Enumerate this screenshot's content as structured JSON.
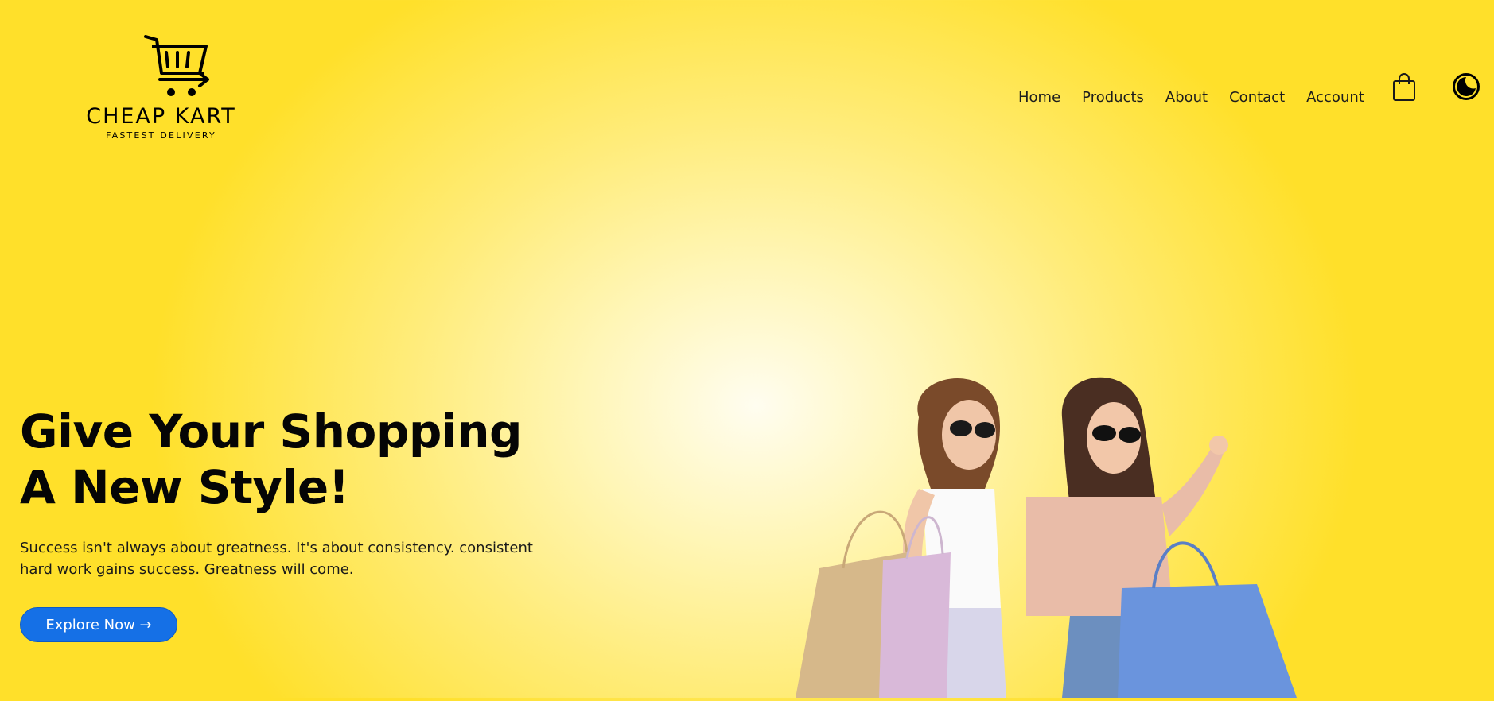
{
  "brand": {
    "name": "CHEAP KART",
    "tagline": "FASTEST DELIVERY"
  },
  "nav": {
    "items": [
      {
        "label": "Home"
      },
      {
        "label": "Products"
      },
      {
        "label": "About"
      },
      {
        "label": "Contact"
      },
      {
        "label": "Account"
      }
    ],
    "cart_icon": "shopping-bag-icon",
    "theme_icon": "moon-icon"
  },
  "hero": {
    "headline_line1": "Give Your Shopping",
    "headline_line2": "A New Style!",
    "subtext_line1": "Success isn't always about greatness. It's about consistency. consistent",
    "subtext_line2": "hard work gains success. Greatness will come.",
    "cta_label": "Explore Now →"
  },
  "colors": {
    "background": "#ffe02a",
    "accent": "#1570e6",
    "text": "#050505"
  }
}
